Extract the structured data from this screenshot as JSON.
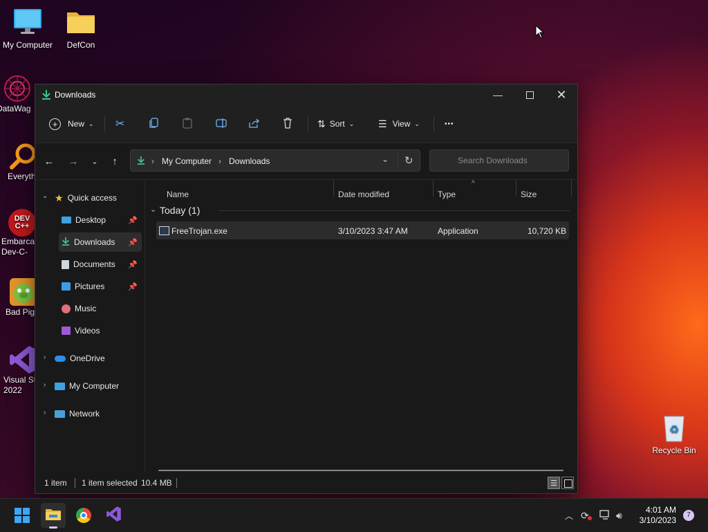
{
  "desktop": {
    "icons": [
      {
        "label": "My Computer"
      },
      {
        "label": "DefCon"
      },
      {
        "label": "DataWag"
      },
      {
        "label": "Everyth"
      },
      {
        "label": "Embarca Dev-C-"
      },
      {
        "label": "Bad Pig"
      },
      {
        "label": "Visual St 2022"
      },
      {
        "label": "Recycle Bin"
      }
    ],
    "dev_icon_text": "DEV C++"
  },
  "window": {
    "title": "Downloads",
    "toolbar": {
      "new_label": "New",
      "sort_label": "Sort",
      "view_label": "View",
      "more_label": "•••"
    },
    "address": {
      "crumbs": [
        "My Computer",
        "Downloads"
      ],
      "search_placeholder": "Search Downloads"
    },
    "sidebar": {
      "quick_access": "Quick access",
      "items": [
        {
          "label": "Desktop"
        },
        {
          "label": "Downloads"
        },
        {
          "label": "Documents"
        },
        {
          "label": "Pictures"
        },
        {
          "label": "Music"
        },
        {
          "label": "Videos"
        }
      ],
      "onedrive": "OneDrive",
      "my_computer": "My Computer",
      "network": "Network"
    },
    "columns": {
      "name": "Name",
      "date": "Date modified",
      "type": "Type",
      "size": "Size"
    },
    "group": "Today (1)",
    "files": [
      {
        "name": "FreeTrojan.exe",
        "date": "3/10/2023 3:47 AM",
        "type": "Application",
        "size": "10,720 KB"
      }
    ],
    "status": {
      "count": "1 item",
      "selected": "1 item selected",
      "size": "10.4 MB"
    }
  },
  "taskbar": {
    "time": "4:01 AM",
    "date": "3/10/2023",
    "notification_count": "7"
  }
}
